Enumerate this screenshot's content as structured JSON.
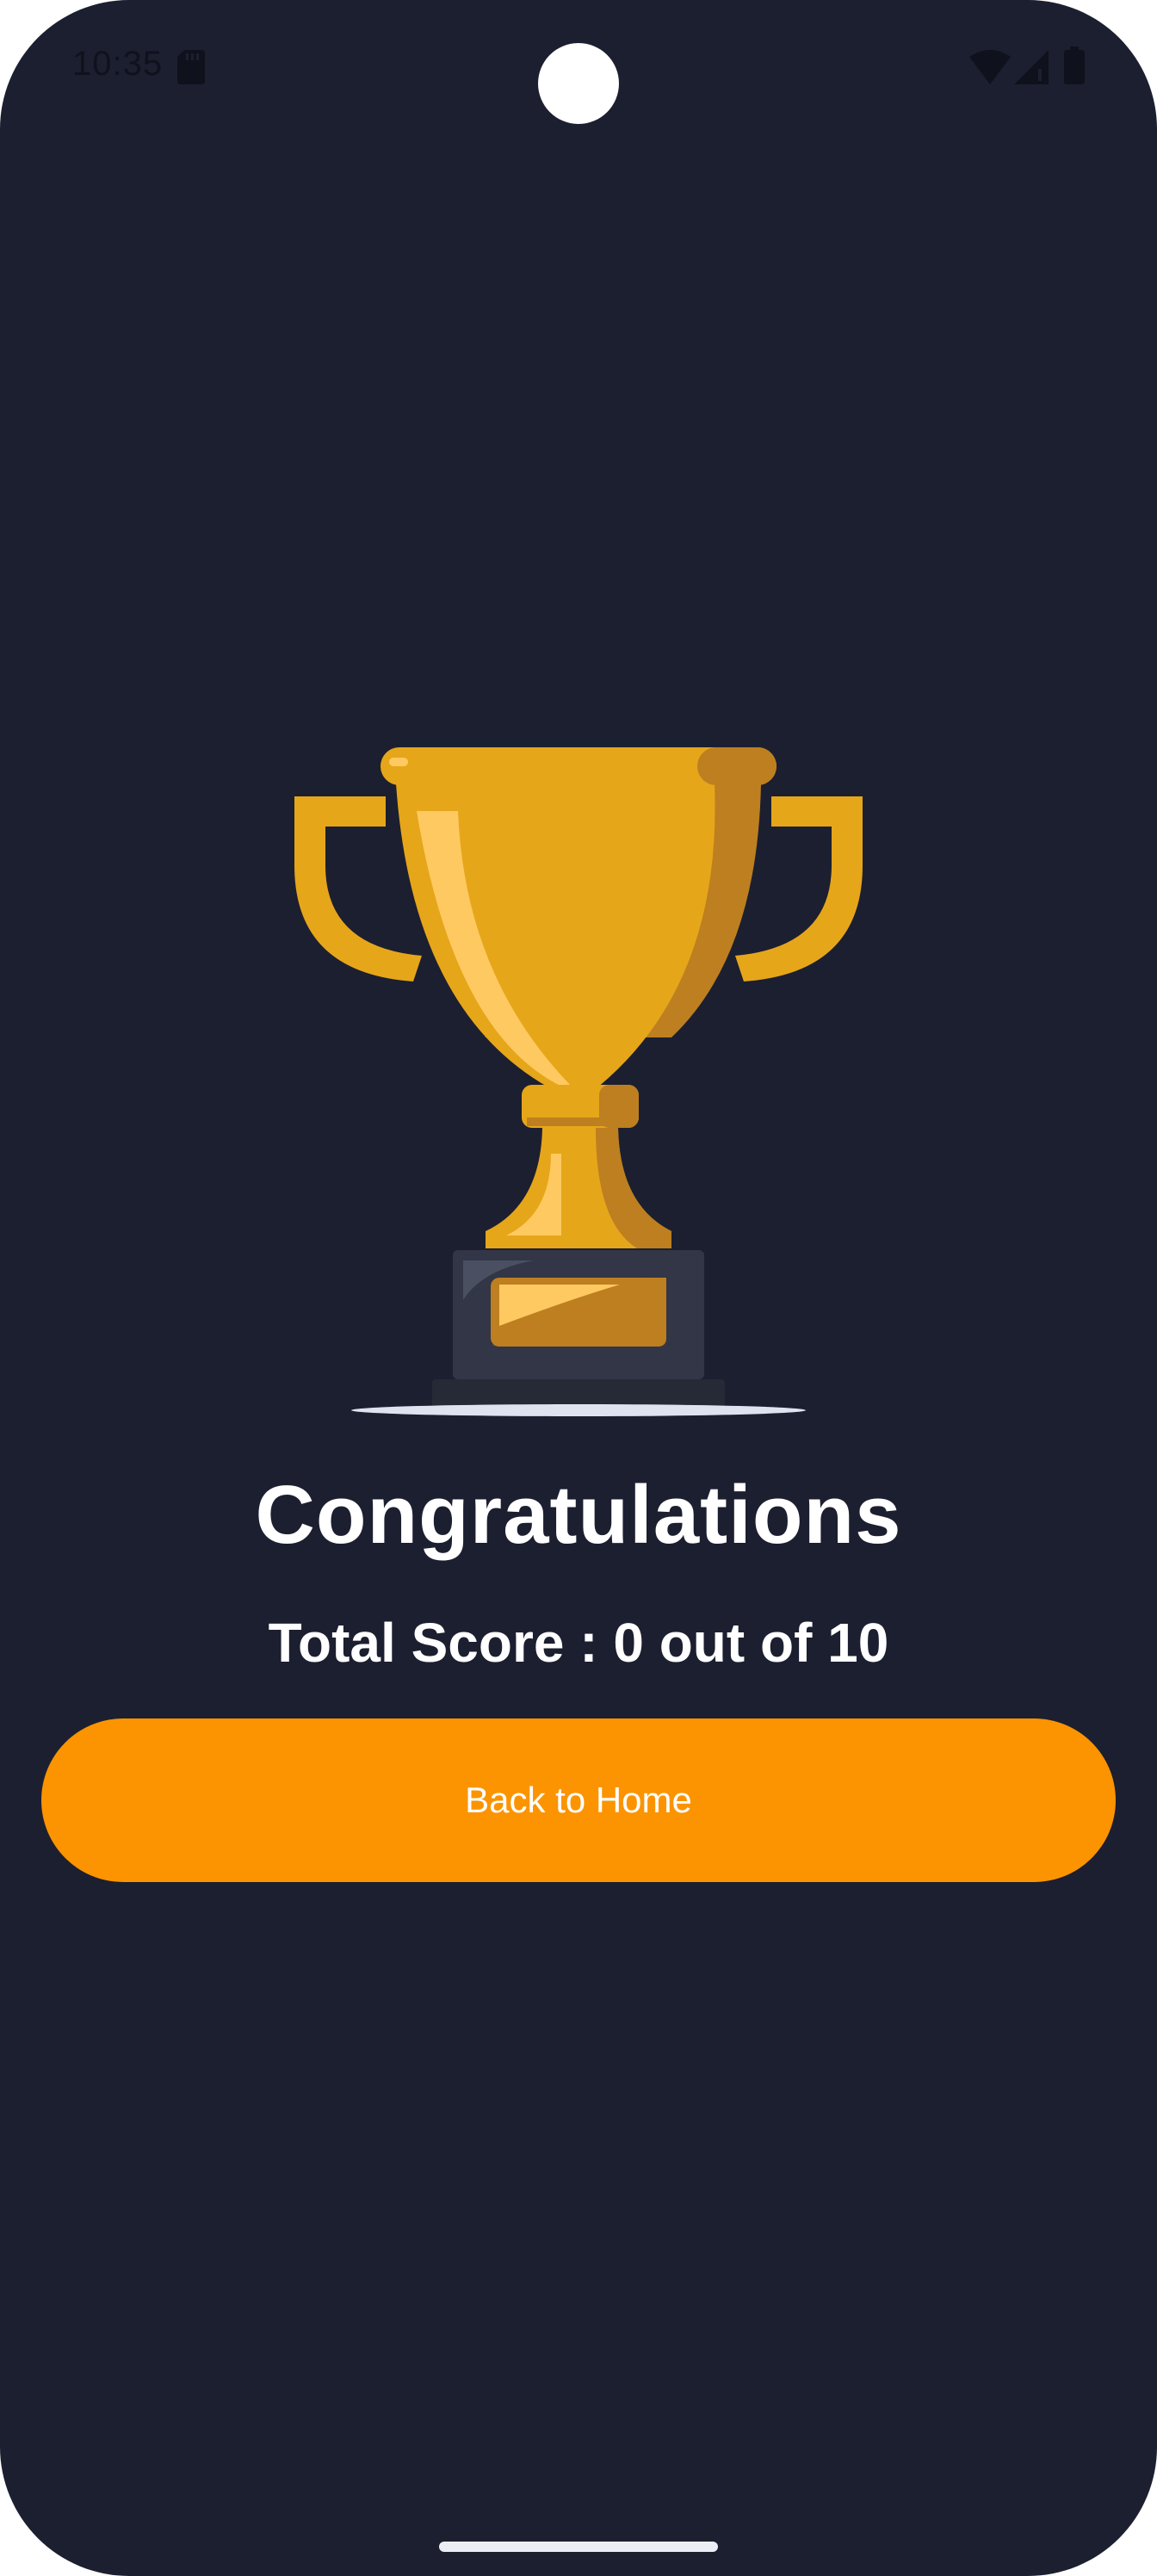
{
  "status_bar": {
    "time": "10:35",
    "icons": [
      "sd-card-icon",
      "wifi-icon",
      "signal-icon",
      "battery-icon"
    ]
  },
  "result": {
    "illustration": "trophy-icon",
    "title": "Congratulations",
    "score_text": "Total Score : 0 out of 10"
  },
  "actions": {
    "back_home_label": "Back to Home"
  },
  "colors": {
    "background": "#1c1f30",
    "accent": "#fb9400",
    "trophy_gold": "#e6a61a",
    "trophy_shadow": "#bd7f20",
    "base": "#323646",
    "text": "#ffffff"
  }
}
